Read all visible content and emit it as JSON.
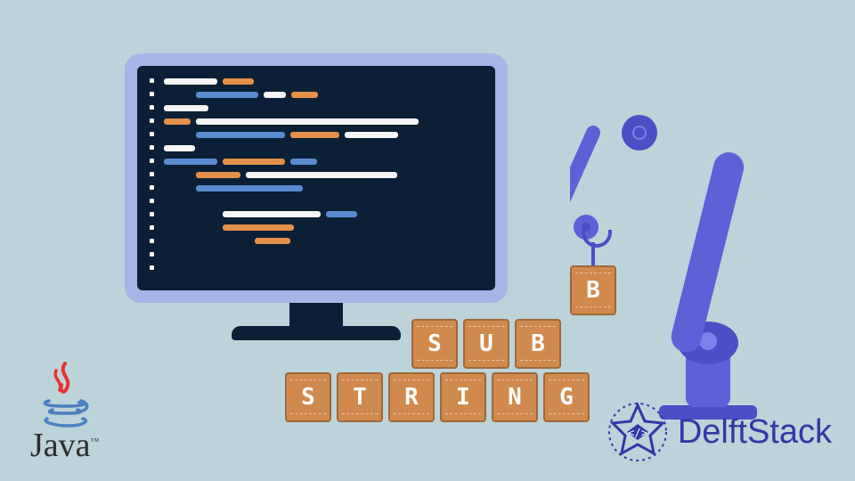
{
  "letters": {
    "hanging": "B",
    "top_row": [
      "S",
      "U",
      "B"
    ],
    "bottom_row": [
      "S",
      "T",
      "R",
      "I",
      "N",
      "G"
    ]
  },
  "brand": {
    "java": "Java",
    "java_tm": "™",
    "delft": "DelftStack"
  }
}
